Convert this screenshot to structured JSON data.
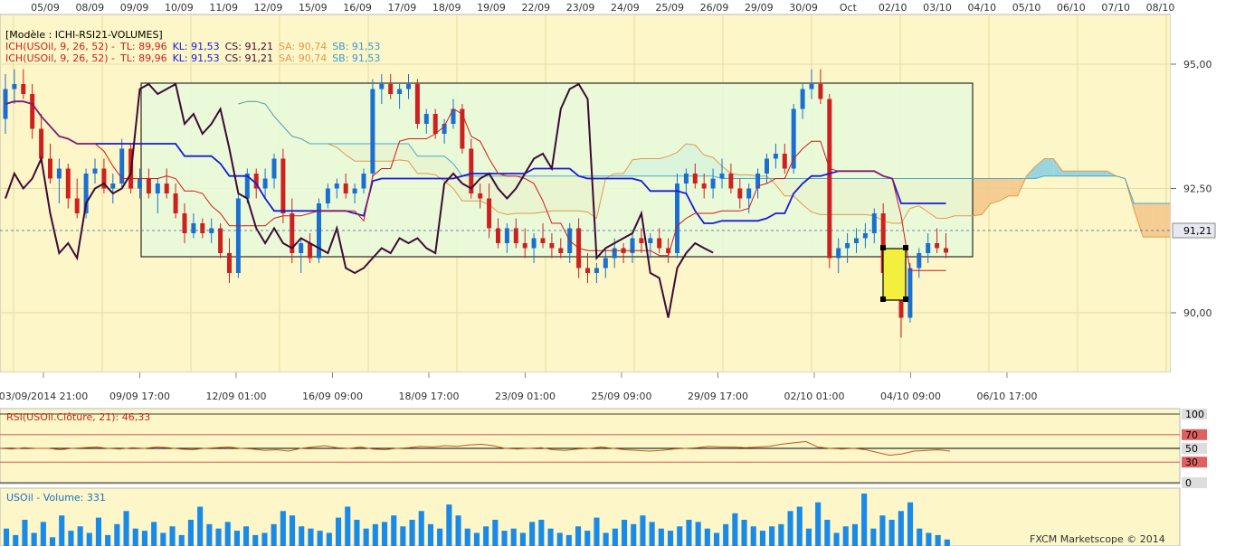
{
  "top_dates": [
    "05/09",
    "08/09",
    "09/09",
    "10/09",
    "11/09",
    "12/09",
    "15/09",
    "16/09",
    "17/09",
    "18/09",
    "19/09",
    "22/09",
    "23/09",
    "24/09",
    "25/09",
    "26/09",
    "29/09",
    "30/09",
    "Oct",
    "02/10",
    "03/10",
    "04/10",
    "05/10",
    "06/10",
    "07/10",
    "08/10"
  ],
  "model_label": "[Modèle : ICHI-RSI21-VOLUMES]",
  "legend": {
    "prefix": "ICH(USOil, 9, 26, 52) -",
    "tl": "TL: 89,96",
    "kl": "KL: 91,53",
    "cs": "CS: 91,21",
    "sa": "SA: 90,74",
    "sb": "SB: 91,53"
  },
  "colors": {
    "main_bg": "#fcf6c8",
    "box_fill": "#e6fadc",
    "up": "#1a6fd1",
    "down": "#cf2020",
    "tenkan": "#d01818",
    "kijun": "#1a1ad6",
    "chikou": "#3d0a36",
    "senkou_a": "#e09a4a",
    "senkou_b": "#4aa8c8",
    "bull_cloud": "#8fd0e0",
    "bear_cloud": "#f4c88c"
  },
  "bottom_dates": [
    "03/09/2014 21:00",
    "09/09 17:00",
    "12/09 01:00",
    "16/09 09:00",
    "18/09 17:00",
    "23/09 01:00",
    "25/09 09:00",
    "29/09 17:00",
    "02/10 01:00",
    "04/10 09:00",
    "06/10 17:00"
  ],
  "rsi_label": "RSI(USOil.Clôture, 21): 46,33",
  "volume_label": "USOil - Volume: 331",
  "footer": "FXCM Marketscope © 2014",
  "chart_data": [
    {
      "type": "candlestick",
      "title": "USOil",
      "y_ticks": [
        "95,00",
        "92,50",
        "90,00"
      ],
      "y_tick_values": [
        95,
        92.5,
        90
      ],
      "ylim": [
        88.8,
        96.0
      ],
      "last_price_label": "91,21",
      "last_price": 91.21,
      "grid": true,
      "candles_ohlc": [
        [
          93.9,
          94.8,
          93.6,
          94.5
        ],
        [
          94.5,
          94.9,
          94.2,
          94.6
        ],
        [
          94.6,
          94.9,
          94.3,
          94.4
        ],
        [
          94.4,
          94.6,
          93.5,
          93.7
        ],
        [
          93.7,
          94.0,
          93.0,
          93.1
        ],
        [
          93.1,
          93.4,
          92.6,
          92.7
        ],
        [
          92.7,
          93.1,
          92.2,
          92.9
        ],
        [
          92.9,
          93.0,
          92.1,
          92.3
        ],
        [
          92.3,
          92.7,
          91.9,
          92.0
        ],
        [
          92.0,
          92.9,
          91.9,
          92.8
        ],
        [
          92.8,
          93.1,
          92.6,
          92.9
        ],
        [
          92.9,
          93.1,
          92.4,
          92.5
        ],
        [
          92.5,
          92.8,
          92.2,
          92.6
        ],
        [
          92.6,
          93.5,
          92.5,
          93.3
        ],
        [
          93.3,
          93.4,
          92.4,
          92.5
        ],
        [
          92.5,
          92.9,
          92.3,
          92.7
        ],
        [
          92.7,
          92.9,
          92.3,
          92.4
        ],
        [
          92.4,
          92.7,
          92.0,
          92.6
        ],
        [
          92.6,
          92.9,
          92.3,
          92.4
        ],
        [
          92.4,
          92.6,
          91.9,
          92.0
        ],
        [
          92.0,
          92.2,
          91.4,
          91.6
        ],
        [
          91.6,
          92.0,
          91.5,
          91.8
        ],
        [
          91.8,
          91.9,
          91.5,
          91.6
        ],
        [
          91.6,
          91.9,
          91.4,
          91.7
        ],
        [
          91.7,
          91.8,
          91.1,
          91.2
        ],
        [
          91.2,
          91.5,
          90.6,
          90.8
        ],
        [
          90.8,
          92.4,
          90.7,
          92.3
        ],
        [
          92.3,
          92.9,
          92.2,
          92.8
        ],
        [
          92.8,
          92.9,
          92.3,
          92.5
        ],
        [
          92.5,
          92.9,
          92.3,
          92.7
        ],
        [
          92.7,
          93.2,
          92.5,
          93.1
        ],
        [
          93.1,
          93.3,
          91.8,
          92.0
        ],
        [
          92.0,
          92.3,
          91.0,
          91.2
        ],
        [
          91.2,
          91.5,
          90.8,
          91.4
        ],
        [
          91.4,
          91.6,
          91.0,
          91.1
        ],
        [
          91.1,
          92.3,
          91.0,
          92.2
        ],
        [
          92.2,
          92.6,
          92.1,
          92.5
        ],
        [
          92.5,
          92.7,
          92.3,
          92.6
        ],
        [
          92.6,
          92.8,
          92.3,
          92.4
        ],
        [
          92.4,
          92.6,
          92.2,
          92.5
        ],
        [
          92.5,
          92.9,
          92.4,
          92.8
        ],
        [
          92.8,
          94.7,
          92.7,
          94.5
        ],
        [
          94.5,
          94.8,
          94.2,
          94.6
        ],
        [
          94.6,
          94.8,
          94.3,
          94.4
        ],
        [
          94.4,
          94.6,
          94.1,
          94.5
        ],
        [
          94.5,
          94.8,
          94.3,
          94.6
        ],
        [
          94.6,
          94.7,
          93.7,
          93.8
        ],
        [
          93.8,
          94.1,
          93.6,
          94.0
        ],
        [
          94.0,
          94.1,
          93.5,
          93.6
        ],
        [
          93.6,
          93.9,
          93.4,
          93.8
        ],
        [
          93.8,
          94.3,
          93.7,
          94.1
        ],
        [
          94.1,
          94.2,
          93.2,
          93.3
        ],
        [
          93.3,
          93.5,
          92.3,
          92.4
        ],
        [
          92.4,
          92.6,
          92.1,
          92.3
        ],
        [
          92.3,
          92.6,
          91.5,
          91.7
        ],
        [
          91.7,
          91.9,
          91.3,
          91.4
        ],
        [
          91.4,
          91.8,
          91.2,
          91.7
        ],
        [
          91.7,
          91.9,
          91.3,
          91.4
        ],
        [
          91.4,
          91.7,
          91.1,
          91.3
        ],
        [
          91.3,
          91.6,
          91.0,
          91.5
        ],
        [
          91.5,
          91.8,
          91.3,
          91.4
        ],
        [
          91.4,
          91.6,
          91.1,
          91.3
        ],
        [
          91.3,
          91.5,
          91.1,
          91.2
        ],
        [
          91.2,
          91.8,
          91.0,
          91.7
        ],
        [
          91.7,
          91.9,
          90.7,
          90.9
        ],
        [
          90.9,
          91.2,
          90.6,
          90.8
        ],
        [
          90.8,
          91.0,
          90.6,
          90.9
        ],
        [
          90.9,
          91.3,
          90.7,
          91.1
        ],
        [
          91.1,
          91.5,
          90.9,
          91.3
        ],
        [
          91.3,
          91.4,
          91.0,
          91.2
        ],
        [
          91.2,
          91.6,
          91.0,
          91.5
        ],
        [
          91.5,
          91.7,
          91.2,
          91.4
        ],
        [
          91.4,
          91.6,
          91.1,
          91.5
        ],
        [
          91.5,
          91.7,
          91.2,
          91.3
        ],
        [
          91.3,
          91.5,
          91.0,
          91.2
        ],
        [
          91.2,
          92.8,
          91.1,
          92.6
        ],
        [
          92.6,
          92.9,
          92.4,
          92.8
        ],
        [
          92.8,
          93.0,
          92.5,
          92.6
        ],
        [
          92.6,
          92.8,
          92.3,
          92.5
        ],
        [
          92.5,
          92.9,
          92.3,
          92.7
        ],
        [
          92.7,
          93.1,
          92.5,
          92.8
        ],
        [
          92.8,
          93.0,
          92.4,
          92.5
        ],
        [
          92.5,
          92.7,
          92.1,
          92.3
        ],
        [
          92.3,
          92.6,
          92.0,
          92.5
        ],
        [
          92.5,
          92.9,
          92.3,
          92.8
        ],
        [
          92.8,
          93.2,
          92.6,
          93.1
        ],
        [
          93.1,
          93.4,
          92.9,
          93.2
        ],
        [
          93.2,
          93.4,
          92.8,
          92.9
        ],
        [
          92.9,
          94.2,
          92.8,
          94.1
        ],
        [
          94.1,
          94.6,
          93.9,
          94.5
        ],
        [
          94.5,
          94.9,
          94.3,
          94.6
        ],
        [
          94.6,
          94.9,
          94.2,
          94.3
        ],
        [
          94.3,
          94.4,
          90.9,
          91.1
        ],
        [
          91.1,
          91.5,
          90.8,
          91.3
        ],
        [
          91.3,
          91.6,
          91.0,
          91.4
        ],
        [
          91.4,
          91.7,
          91.2,
          91.5
        ],
        [
          91.5,
          91.8,
          91.3,
          91.6
        ],
        [
          91.6,
          92.1,
          91.4,
          92.0
        ],
        [
          92.0,
          92.2,
          90.6,
          90.8
        ],
        [
          90.8,
          91.0,
          90.5,
          90.7
        ],
        [
          90.7,
          90.9,
          89.5,
          89.9
        ],
        [
          89.9,
          91.0,
          89.8,
          90.9
        ],
        [
          90.9,
          91.3,
          90.7,
          91.2
        ],
        [
          91.2,
          91.6,
          91.0,
          91.4
        ],
        [
          91.4,
          91.7,
          91.2,
          91.3
        ],
        [
          91.3,
          91.6,
          91.1,
          91.21
        ]
      ]
    },
    {
      "type": "line",
      "title": "RSI(USOil.Clôture, 21)",
      "y_ticks": [
        "100",
        "70",
        "50",
        "30",
        "0"
      ],
      "y_tick_values": [
        100,
        70,
        50,
        30,
        0
      ],
      "ylim": [
        0,
        100
      ],
      "last_value": 46.33,
      "series": [
        {
          "values": [
            50,
            49,
            51,
            50,
            50,
            48,
            50,
            51,
            52,
            50,
            49,
            51,
            50,
            52,
            51,
            49,
            48,
            50,
            51,
            52,
            50,
            49,
            47,
            48,
            46,
            50,
            52,
            54,
            51,
            50,
            52,
            49,
            48,
            50,
            51,
            53,
            52,
            54,
            53,
            55,
            56,
            54,
            50,
            49,
            50,
            51,
            48,
            47,
            49,
            50,
            52,
            50,
            48,
            47,
            46,
            47,
            49,
            50,
            51,
            53,
            52,
            52,
            51,
            52,
            53,
            56,
            58,
            60,
            52,
            50,
            49,
            50,
            48,
            44,
            40,
            42,
            46,
            47,
            48,
            46
          ]
        }
      ]
    },
    {
      "type": "bar",
      "title": "USOil - Volume",
      "last_value": 331,
      "series": [
        {
          "values": [
            40,
            25,
            60,
            30,
            55,
            20,
            70,
            35,
            45,
            30,
            65,
            25,
            50,
            80,
            40,
            35,
            55,
            30,
            45,
            25,
            60,
            90,
            50,
            40,
            55,
            35,
            45,
            25,
            30,
            50,
            80,
            70,
            45,
            40,
            35,
            30,
            65,
            90,
            60,
            40,
            50,
            55,
            70,
            45,
            60,
            80,
            50,
            40,
            95,
            70,
            40,
            30,
            45,
            60,
            35,
            40,
            30,
            55,
            60,
            40,
            30,
            25,
            45,
            35,
            65,
            30,
            40,
            60,
            50,
            70,
            55,
            40,
            35,
            45,
            60,
            55,
            40,
            30,
            50,
            75,
            60,
            45,
            35,
            45,
            50,
            80,
            90,
            40,
            100,
            60,
            30,
            45,
            50,
            120,
            40,
            70,
            60,
            80,
            100,
            40,
            30,
            25,
            15
          ]
        }
      ]
    }
  ]
}
